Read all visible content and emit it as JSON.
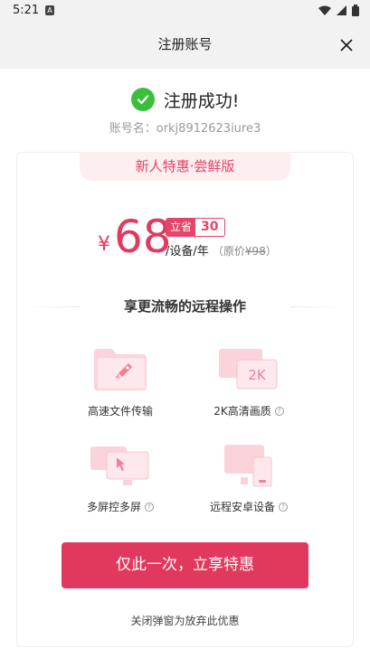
{
  "status_bar": {
    "time": "5:21",
    "notification_glyph": "A"
  },
  "header": {
    "title": "注册账号",
    "close_icon": "close-icon"
  },
  "success": {
    "text": "注册成功!",
    "account": "账号名：orkj8912623iure3"
  },
  "offer": {
    "tab_label": "新人特惠·尝鲜版",
    "currency": "¥",
    "price": "68",
    "badge_label": "立省",
    "badge_value": "30",
    "unit": "/设备/年",
    "original_prefix": "（原价",
    "original_price": "¥98",
    "original_suffix": "）"
  },
  "section_title": "享更流畅的远程操作",
  "features": [
    {
      "label": "高速文件传输",
      "icon": "rocket-folder-icon",
      "has_help": false
    },
    {
      "label": "2K高清画质",
      "icon": "2k-monitor-icon",
      "has_help": true
    },
    {
      "label": "多屏控多屏",
      "icon": "multi-screen-icon",
      "has_help": true
    },
    {
      "label": "远程安卓设备",
      "icon": "android-device-icon",
      "has_help": true
    }
  ],
  "feature_2k_text": "2K",
  "help_glyph": "?",
  "cta_label": "仅此一次，立享特惠",
  "dismiss_text": "关闭弹窗为放弃此优惠",
  "colors": {
    "accent": "#e0395d",
    "success": "#3bbf3b",
    "tab_bg": "#fdeef0"
  }
}
